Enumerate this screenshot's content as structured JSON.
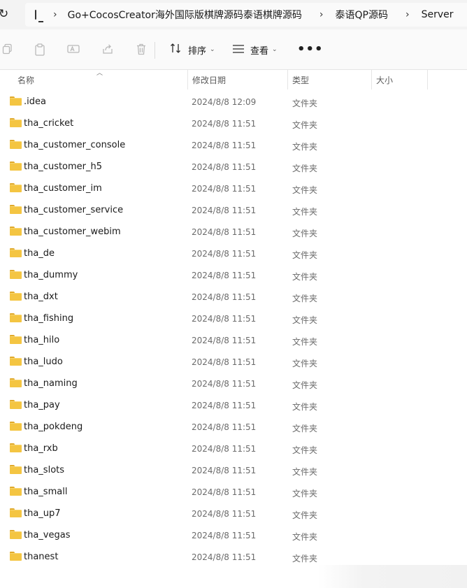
{
  "address_bar": {
    "breadcrumbs": [
      "Go+CocosCreator海外国际版棋牌源码泰语棋牌源码",
      "泰语QP源码",
      "Server"
    ]
  },
  "toolbar": {
    "sort_label": "排序",
    "view_label": "查看",
    "more_label": "•••"
  },
  "columns": {
    "name": "名称",
    "modified": "修改日期",
    "type": "类型",
    "size": "大小"
  },
  "files": [
    {
      "name": ".idea",
      "modified": "2024/8/8 12:09",
      "type": "文件夹"
    },
    {
      "name": "tha_cricket",
      "modified": "2024/8/8 11:51",
      "type": "文件夹"
    },
    {
      "name": "tha_customer_console",
      "modified": "2024/8/8 11:51",
      "type": "文件夹"
    },
    {
      "name": "tha_customer_h5",
      "modified": "2024/8/8 11:51",
      "type": "文件夹"
    },
    {
      "name": "tha_customer_im",
      "modified": "2024/8/8 11:51",
      "type": "文件夹"
    },
    {
      "name": "tha_customer_service",
      "modified": "2024/8/8 11:51",
      "type": "文件夹"
    },
    {
      "name": "tha_customer_webim",
      "modified": "2024/8/8 11:51",
      "type": "文件夹"
    },
    {
      "name": "tha_de",
      "modified": "2024/8/8 11:51",
      "type": "文件夹"
    },
    {
      "name": "tha_dummy",
      "modified": "2024/8/8 11:51",
      "type": "文件夹"
    },
    {
      "name": "tha_dxt",
      "modified": "2024/8/8 11:51",
      "type": "文件夹"
    },
    {
      "name": "tha_fishing",
      "modified": "2024/8/8 11:51",
      "type": "文件夹"
    },
    {
      "name": "tha_hilo",
      "modified": "2024/8/8 11:51",
      "type": "文件夹"
    },
    {
      "name": "tha_ludo",
      "modified": "2024/8/8 11:51",
      "type": "文件夹"
    },
    {
      "name": "tha_naming",
      "modified": "2024/8/8 11:51",
      "type": "文件夹"
    },
    {
      "name": "tha_pay",
      "modified": "2024/8/8 11:51",
      "type": "文件夹"
    },
    {
      "name": "tha_pokdeng",
      "modified": "2024/8/8 11:51",
      "type": "文件夹"
    },
    {
      "name": "tha_rxb",
      "modified": "2024/8/8 11:51",
      "type": "文件夹"
    },
    {
      "name": "tha_slots",
      "modified": "2024/8/8 11:51",
      "type": "文件夹"
    },
    {
      "name": "tha_small",
      "modified": "2024/8/8 11:51",
      "type": "文件夹"
    },
    {
      "name": "tha_up7",
      "modified": "2024/8/8 11:51",
      "type": "文件夹"
    },
    {
      "name": "tha_vegas",
      "modified": "2024/8/8 11:51",
      "type": "文件夹"
    },
    {
      "name": "thanest",
      "modified": "2024/8/8 11:51",
      "type": "文件夹"
    }
  ]
}
